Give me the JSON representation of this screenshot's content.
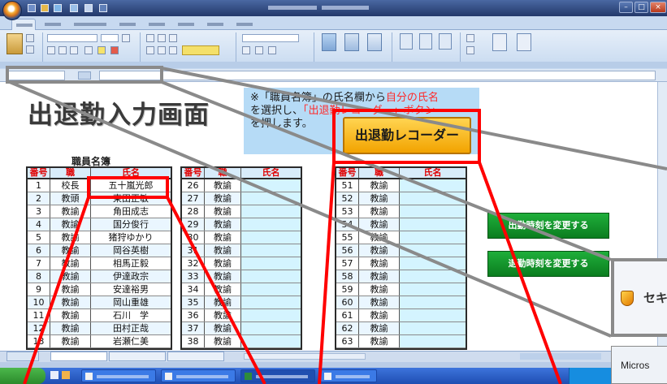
{
  "sheet": {
    "heading": "出退勤入力画面",
    "note": {
      "line1_a": "※「職員名簿」の氏名欄から",
      "line1_b": "自分の氏名",
      "line2_a": "を選択し、",
      "line2_b": "「出退勤レコーダー」ボタン",
      "line3": "を押します。"
    },
    "recorder_button": "出退勤レコーダー",
    "roster_title": "職員名簿",
    "columns": [
      "番号",
      "職",
      "氏名"
    ],
    "tables": [
      {
        "rows": [
          [
            "1",
            "校長",
            "五十嵐光郎"
          ],
          [
            "2",
            "教頭",
            "東田正敏"
          ],
          [
            "3",
            "教諭",
            "角田成志"
          ],
          [
            "4",
            "教諭",
            "国分俊行"
          ],
          [
            "5",
            "教諭",
            "猪狩ゆかり"
          ],
          [
            "6",
            "教諭",
            "岡谷英樹"
          ],
          [
            "7",
            "教諭",
            "相馬正毅"
          ],
          [
            "8",
            "教諭",
            "伊達政宗"
          ],
          [
            "9",
            "教諭",
            "安達裕男"
          ],
          [
            "10",
            "教諭",
            "岡山重雄"
          ],
          [
            "11",
            "教諭",
            "石川　学"
          ],
          [
            "12",
            "教諭",
            "田村正哉"
          ],
          [
            "13",
            "教諭",
            "岩瀬仁美"
          ]
        ]
      },
      {
        "rows": [
          [
            "26",
            "教諭",
            ""
          ],
          [
            "27",
            "教諭",
            ""
          ],
          [
            "28",
            "教諭",
            ""
          ],
          [
            "29",
            "教諭",
            ""
          ],
          [
            "30",
            "教諭",
            ""
          ],
          [
            "31",
            "教諭",
            ""
          ],
          [
            "32",
            "教諭",
            ""
          ],
          [
            "33",
            "教諭",
            ""
          ],
          [
            "34",
            "教諭",
            ""
          ],
          [
            "35",
            "教諭",
            ""
          ],
          [
            "36",
            "教諭",
            ""
          ],
          [
            "37",
            "教諭",
            ""
          ],
          [
            "38",
            "教諭",
            ""
          ]
        ]
      },
      {
        "rows": [
          [
            "51",
            "教諭",
            ""
          ],
          [
            "52",
            "教諭",
            ""
          ],
          [
            "53",
            "教諭",
            ""
          ],
          [
            "54",
            "教諭",
            ""
          ],
          [
            "55",
            "教諭",
            ""
          ],
          [
            "56",
            "教諭",
            ""
          ],
          [
            "57",
            "教諭",
            ""
          ],
          [
            "58",
            "教諭",
            ""
          ],
          [
            "59",
            "教諭",
            ""
          ],
          [
            "60",
            "教諭",
            ""
          ],
          [
            "61",
            "教諭",
            ""
          ],
          [
            "62",
            "教諭",
            ""
          ],
          [
            "63",
            "教諭",
            ""
          ]
        ]
      }
    ],
    "clock_in_button": "出勤時刻を変更する",
    "clock_out_button": "退勤時刻を変更する"
  },
  "dialog": {
    "title": "セキ",
    "icon": "shield-icon"
  },
  "background_window": {
    "title": "Micros"
  },
  "colors": {
    "annotation_red": "#ff0000",
    "annotation_gray": "#8a8a8a",
    "recorder_button": "#f7b500",
    "change_time_buttons": "#129a2d",
    "note_background": "#b6dbf6",
    "title_bar": "#22386a"
  }
}
